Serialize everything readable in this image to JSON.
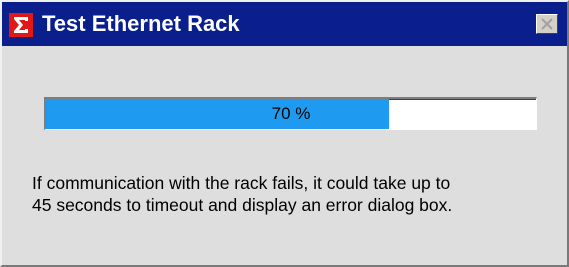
{
  "window": {
    "title": "Test Ethernet Rack",
    "icons": {
      "app": "sigma-app-icon",
      "close": "close-icon"
    }
  },
  "progress": {
    "value": 0.7,
    "label": "70 %",
    "fill_color": "#1e9bf0"
  },
  "message": {
    "line1": "If communication with the rack fails, it could take up to",
    "line2": "45 seconds to timeout and display an error dialog box."
  },
  "colors": {
    "title_bar": "#0a1e8c",
    "app_icon_red": "#e01818",
    "background": "#dedede"
  }
}
